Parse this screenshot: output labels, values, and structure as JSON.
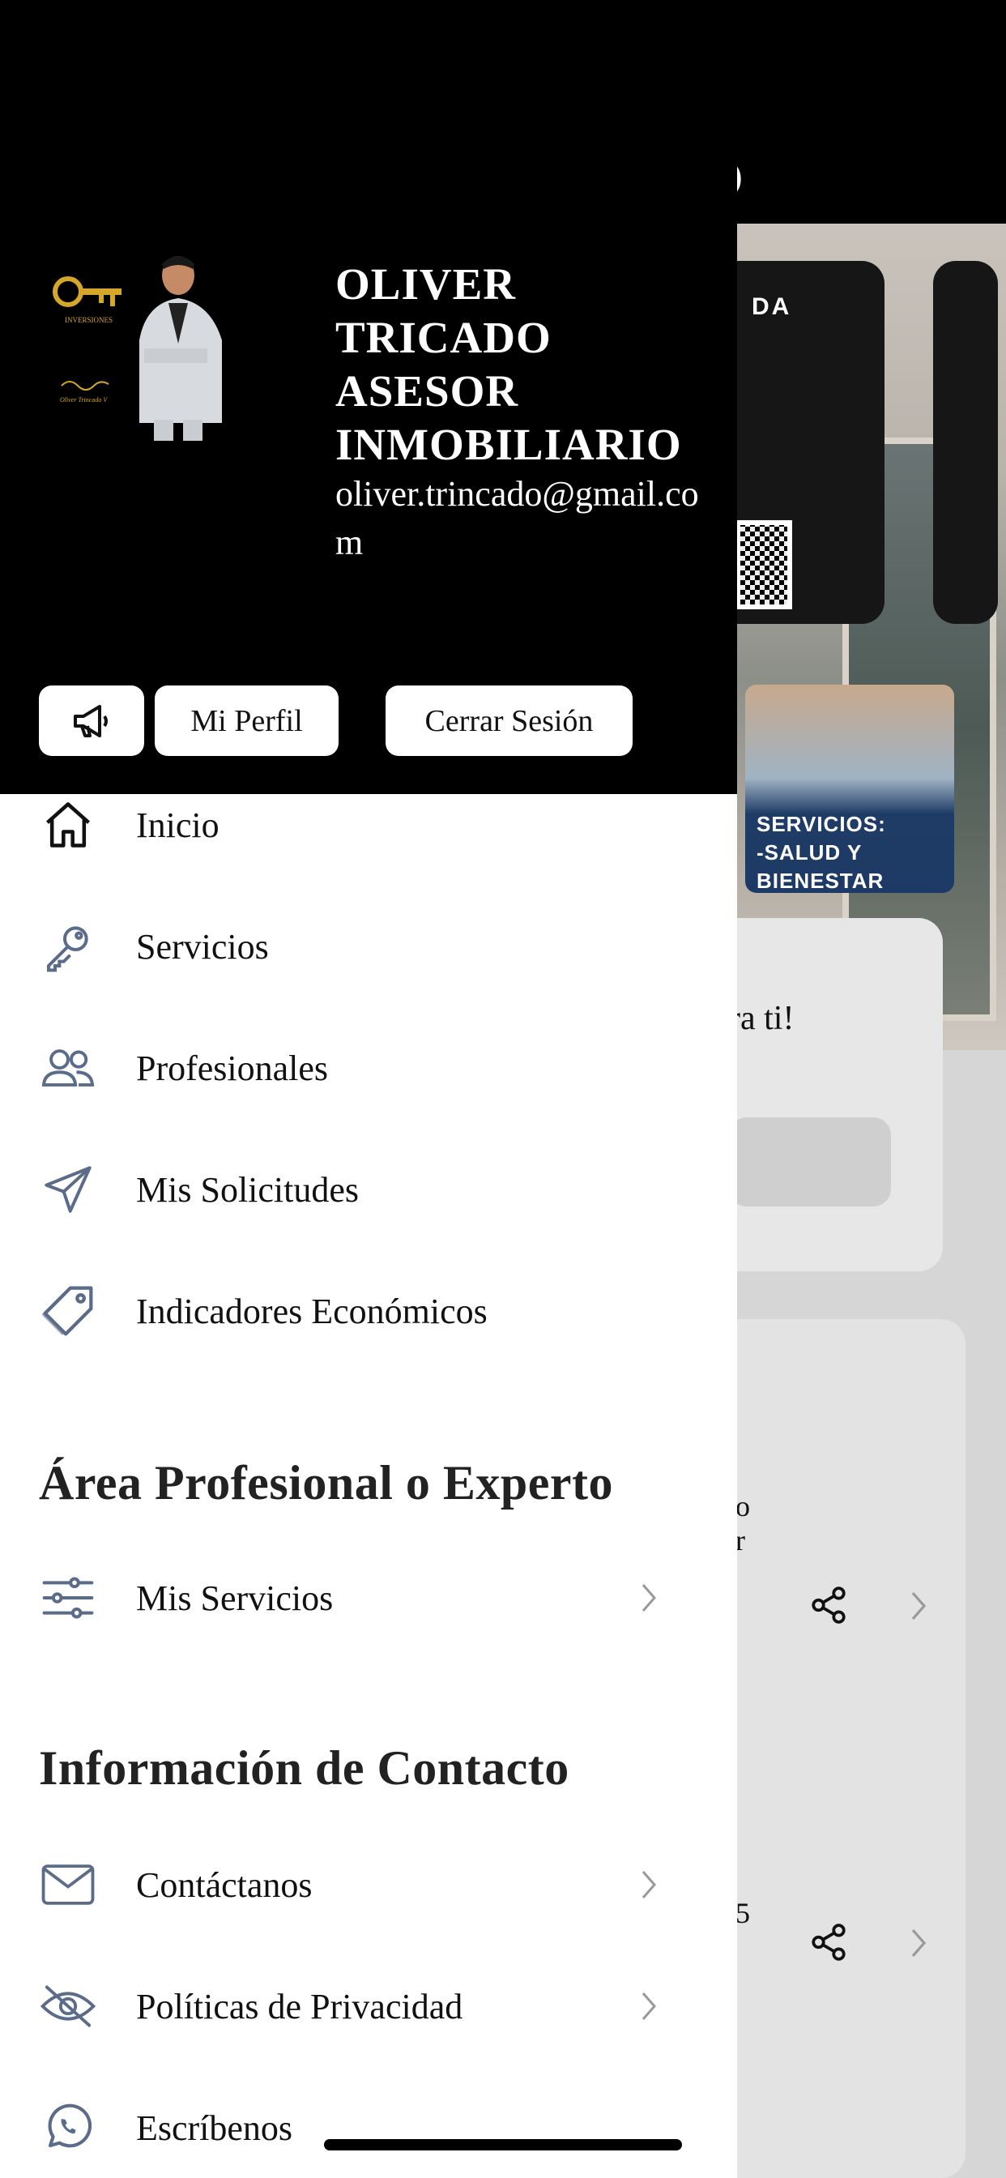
{
  "background": {
    "card_text": "DA",
    "service_label": "SERVICIOS:\n-SALUD Y\nBIENESTAR",
    "card_fragment": "ra ti!",
    "list_fragment_1": "o",
    "list_fragment_2": "r",
    "list_fragment_3": "5"
  },
  "drawer": {
    "user": {
      "name": "OLIVER TRICADO ASESOR INMOBILIARIO",
      "email": "oliver.trincado@gmail.com",
      "avatar_logo_text": "INVERSIONES",
      "avatar_signature": "Oliver Trincado V"
    },
    "buttons": {
      "announce_icon": "megaphone-icon",
      "profile": "Mi Perfil",
      "logout": "Cerrar Sesión"
    },
    "menu": [
      {
        "label": "Inicio",
        "icon": "home-icon"
      },
      {
        "label": "Servicios",
        "icon": "key-icon"
      },
      {
        "label": "Profesionales",
        "icon": "users-icon"
      },
      {
        "label": "Mis Solicitudes",
        "icon": "send-icon"
      },
      {
        "label": "Indicadores Económicos",
        "icon": "tag-icon"
      }
    ],
    "professional_section": {
      "title": "Área Profesional o Experto",
      "items": [
        {
          "label": "Mis Servicios",
          "icon": "sliders-icon"
        }
      ]
    },
    "contact_section": {
      "title": "Información de Contacto",
      "items": [
        {
          "label": "Contáctanos",
          "icon": "mail-icon"
        },
        {
          "label": "Políticas de Privacidad",
          "icon": "eye-off-icon"
        },
        {
          "label": "Escríbenos",
          "icon": "whatsapp-icon"
        }
      ]
    }
  },
  "colors": {
    "header_bg": "#000000",
    "drawer_bg": "#ffffff",
    "icon_stroke": "#5b6b8a",
    "text": "#111111"
  }
}
